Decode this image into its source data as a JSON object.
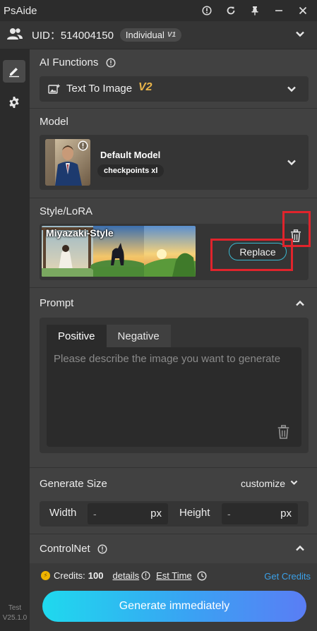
{
  "app": {
    "title": "PsAide"
  },
  "titlebar_icons": [
    "info-icon",
    "refresh-icon",
    "pin-icon",
    "minimize-icon",
    "close-icon"
  ],
  "user": {
    "uid": "UID：514004150",
    "plan": "Individual",
    "plan_version": "V1"
  },
  "sidebar": {
    "items": [
      "edit-icon",
      "gear-icon"
    ],
    "version_env": "Test",
    "version": "V25.1.0"
  },
  "ai_functions": {
    "title": "AI Functions",
    "selected": "Text To Image",
    "selected_version": "V2"
  },
  "model": {
    "title": "Model",
    "name": "Default Model",
    "tag": "checkpoints xl"
  },
  "lora": {
    "title": "Style/LoRA",
    "name": "Miyazaki-Style",
    "replace_label": "Replace"
  },
  "prompt": {
    "title": "Prompt",
    "tabs": [
      "Positive",
      "Negative"
    ],
    "active_tab": "Positive",
    "placeholder": "Please describe the image you want to generate"
  },
  "size": {
    "title": "Generate Size",
    "mode": "customize",
    "width_label": "Width",
    "width_placeholder": "-",
    "height_label": "Height",
    "height_placeholder": "-",
    "unit": "px"
  },
  "controlnet": {
    "title": "ControlNet"
  },
  "footer": {
    "credits_label": "Credits:",
    "credits_value": "100",
    "details_label": "details",
    "est_time_label": "Est Time",
    "get_credits_label": "Get Credits",
    "generate_label": "Generate immediately"
  },
  "colors": {
    "accent_blue": "#3aa0e8",
    "gradient_start": "#1fd9ee",
    "gradient_end": "#5a7df4",
    "highlight_red": "#e0242c",
    "coin": "#f0b400"
  }
}
